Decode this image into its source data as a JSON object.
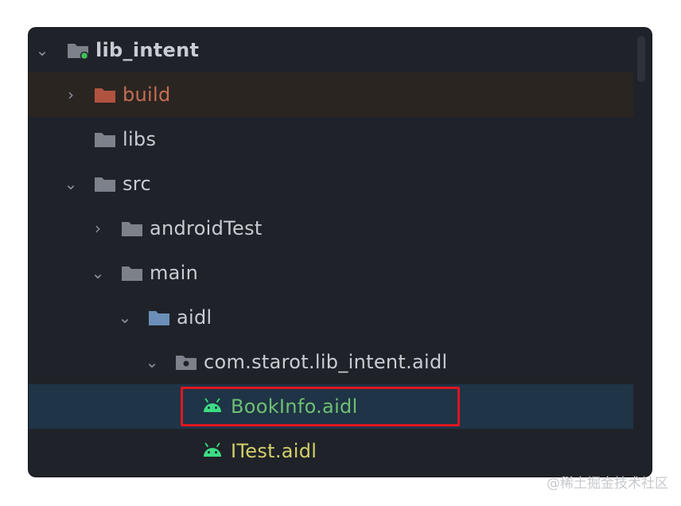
{
  "tree": {
    "rows": [
      {
        "label": "lib_intent",
        "expanded": true,
        "icon": "module-folder-icon"
      },
      {
        "label": "build",
        "expanded": false,
        "icon": "excluded-folder-icon"
      },
      {
        "label": "libs",
        "icon": "folder-icon"
      },
      {
        "label": "src",
        "expanded": true,
        "icon": "folder-icon"
      },
      {
        "label": "androidTest",
        "expanded": false,
        "icon": "folder-icon"
      },
      {
        "label": "main",
        "expanded": true,
        "icon": "folder-icon"
      },
      {
        "label": "aidl",
        "expanded": true,
        "icon": "source-folder-icon"
      },
      {
        "label": "com.starot.lib_intent.aidl",
        "expanded": true,
        "icon": "package-icon"
      },
      {
        "label": "BookInfo.aidl",
        "icon": "android-icon",
        "selected": true
      },
      {
        "label": "ITest.aidl",
        "icon": "android-icon"
      }
    ]
  },
  "watermark": "@稀土掘金技术社区",
  "colors": {
    "panel_bg": "#1f2329",
    "selected_row": "#1f3446",
    "excluded_row": "#2b2522",
    "highlight_box": "#e0161f",
    "android_green": "#3ddc84"
  }
}
